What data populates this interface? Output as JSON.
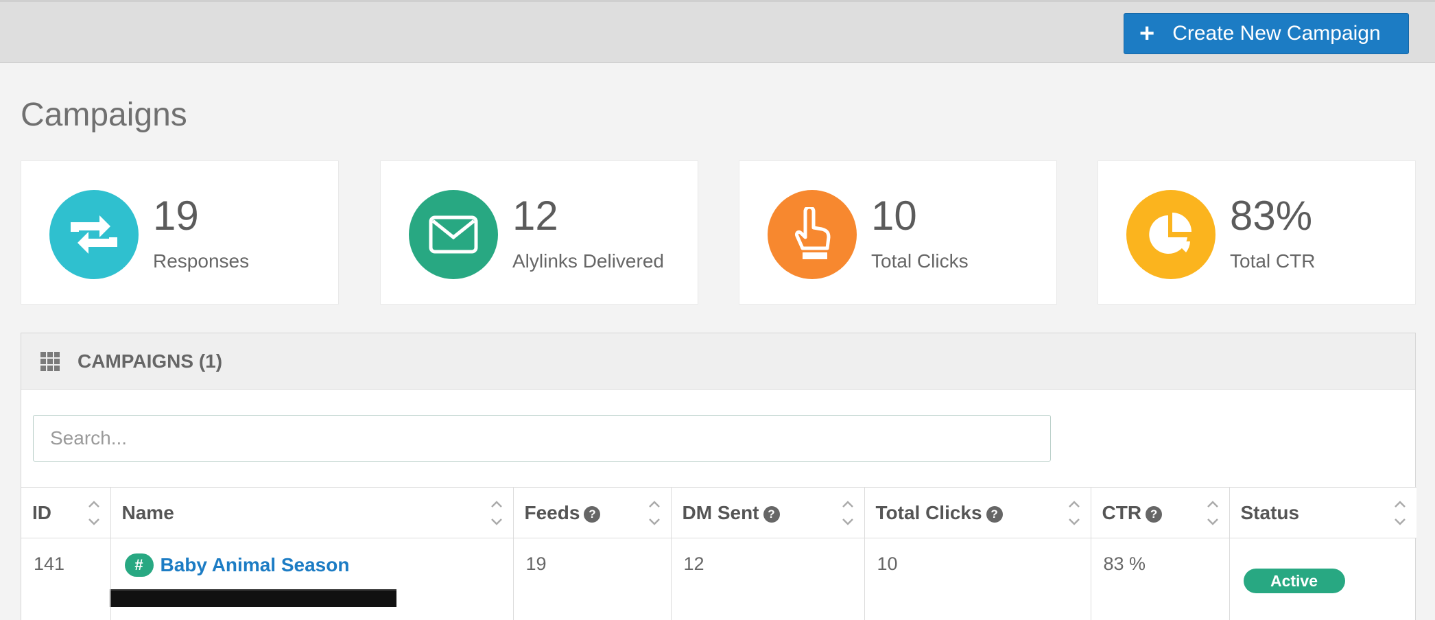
{
  "header": {
    "create_button_icon": "plus-icon",
    "create_button_label": "Create New Campaign",
    "accent_color": "#1c7cc4"
  },
  "page": {
    "title": "Campaigns"
  },
  "stats": [
    {
      "icon": "retweet-icon",
      "color": "#2fc0cf",
      "value": "19",
      "label": "Responses"
    },
    {
      "icon": "envelope-icon",
      "color": "#28a882",
      "value": "12",
      "label": "Alylinks Delivered"
    },
    {
      "icon": "pointer-hand-icon",
      "color": "#f7882f",
      "value": "10",
      "label": "Total Clicks"
    },
    {
      "icon": "pie-chart-icon",
      "color": "#fbb41e",
      "value": "83%",
      "label": "Total CTR"
    }
  ],
  "campaigns_panel": {
    "icon": "grid-icon",
    "title": "CAMPAIGNS (1)",
    "search_placeholder": "Search...",
    "columns": [
      "ID",
      "Name",
      "Feeds",
      "DM Sent",
      "Total Clicks",
      "CTR",
      "Status"
    ],
    "help_columns": [
      "Feeds",
      "DM Sent",
      "Total Clicks",
      "CTR"
    ],
    "rows": [
      {
        "id": "141",
        "name": "Baby Animal Season",
        "hashtag_badge": "#",
        "feeds": "19",
        "dm_sent": "12",
        "total_clicks": "10",
        "ctr": "83 %",
        "status": "Active"
      }
    ]
  }
}
